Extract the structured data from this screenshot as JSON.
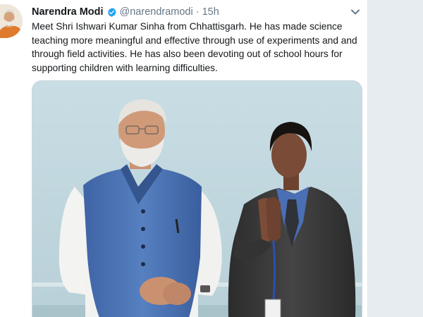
{
  "tweet": {
    "author_name": "Narendra Modi",
    "handle": "@narendramodi",
    "separator": "·",
    "timestamp": "15h",
    "text": "Meet Shri Ishwari Kumar Sinha from Chhattisgarh. He has made science teaching more meaningful and effective through use of experiments and and through field activities. He has also been devoting out of school hours for supporting children with learning difficulties.",
    "verified": true,
    "icons": {
      "verified": "verified-badge-icon",
      "more": "chevron-down-icon"
    }
  },
  "colors": {
    "background": "#e6ecf0",
    "card": "#ffffff",
    "verified_blue": "#1da1f2",
    "secondary_text": "#657786",
    "primary_text": "#14171a"
  }
}
